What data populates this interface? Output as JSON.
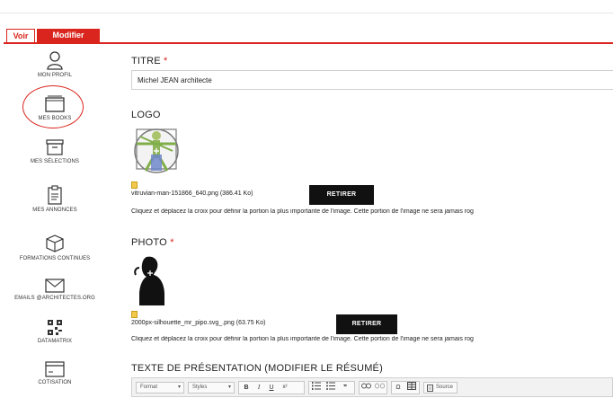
{
  "tabs": {
    "voir": "Voir",
    "modifier": "Modifier"
  },
  "sidebar": {
    "items": [
      {
        "label": "MON PROFIL",
        "icon": "user-icon"
      },
      {
        "label": "MES BOOKS",
        "icon": "books-icon"
      },
      {
        "label": "MES SÉLECTIONS",
        "icon": "archive-box-icon"
      },
      {
        "label": "MES ANNONCES",
        "icon": "clipboard-icon"
      },
      {
        "label": "FORMATIONS CONTINUES",
        "icon": "cube-icon"
      },
      {
        "label": "EMAILS @ARCHITECTES.ORG",
        "icon": "envelope-icon"
      },
      {
        "label": "DATAMATRIX",
        "icon": "qr-code-icon"
      },
      {
        "label": "COTISATION",
        "icon": "card-icon"
      }
    ]
  },
  "form": {
    "titre_label": "TITRE",
    "required_mark": "*",
    "titre_value": "Michel JEAN architecte",
    "logo_label": "LOGO",
    "logo_file": "vitruvian-man-151866_640.png (386.41 Ko)",
    "photo_label": "PHOTO",
    "photo_file": "2000px-silhouette_mr_pipo.svg_.png (63.75 Ko)",
    "retirer_label": "RETIRER",
    "help_text": "Cliquez et déplacez la croix pour définir la portion la plus importante de l'image. Cette portion de l'image ne sera jamais rog",
    "presentation_label": "TEXTE DE PRÉSENTATION (MODIFIER LE RÉSUMÉ)"
  },
  "editor": {
    "format": "Format",
    "styles": "Styles",
    "bold": "B",
    "italic": "I",
    "underline": "U",
    "superscript": "x²",
    "omega": "Ω",
    "source": "Source"
  },
  "colors": {
    "accent": "#d9251d"
  }
}
